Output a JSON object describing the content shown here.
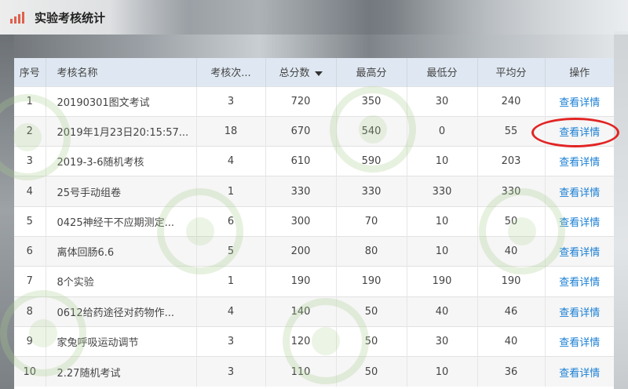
{
  "header": {
    "title": "实验考核统计"
  },
  "table": {
    "columns": [
      {
        "label": "序号"
      },
      {
        "label": "考核名称"
      },
      {
        "label": "考核次..."
      },
      {
        "label": "总分数"
      },
      {
        "label": "最高分"
      },
      {
        "label": "最低分"
      },
      {
        "label": "平均分"
      },
      {
        "label": "操作"
      }
    ],
    "sorted_column": "总分数",
    "sort_direction": "desc",
    "rows": [
      {
        "no": "1",
        "name": "20190301图文考试",
        "count": "3",
        "total": "720",
        "max": "350",
        "min": "30",
        "avg": "240",
        "action": "查看详情"
      },
      {
        "no": "2",
        "name": "2019年1月23日20:15:57...",
        "count": "18",
        "total": "670",
        "max": "540",
        "min": "0",
        "avg": "55",
        "action": "查看详情"
      },
      {
        "no": "3",
        "name": "2019-3-6随机考核",
        "count": "4",
        "total": "610",
        "max": "590",
        "min": "10",
        "avg": "203",
        "action": "查看详情"
      },
      {
        "no": "4",
        "name": "25号手动组卷",
        "count": "1",
        "total": "330",
        "max": "330",
        "min": "330",
        "avg": "330",
        "action": "查看详情"
      },
      {
        "no": "5",
        "name": "0425神经干不应期测定...",
        "count": "6",
        "total": "300",
        "max": "70",
        "min": "10",
        "avg": "50",
        "action": "查看详情"
      },
      {
        "no": "6",
        "name": "离体回肠6.6",
        "count": "5",
        "total": "200",
        "max": "80",
        "min": "10",
        "avg": "40",
        "action": "查看详情"
      },
      {
        "no": "7",
        "name": "8个实验",
        "count": "1",
        "total": "190",
        "max": "190",
        "min": "190",
        "avg": "190",
        "action": "查看详情"
      },
      {
        "no": "8",
        "name": "0612给药途径对药物作...",
        "count": "4",
        "total": "140",
        "max": "50",
        "min": "40",
        "avg": "46",
        "action": "查看详情"
      },
      {
        "no": "9",
        "name": "家兔呼吸运动调节",
        "count": "3",
        "total": "120",
        "max": "50",
        "min": "30",
        "avg": "40",
        "action": "查看详情"
      },
      {
        "no": "10",
        "name": "2.27随机考试",
        "count": "3",
        "total": "110",
        "max": "50",
        "min": "10",
        "avg": "36",
        "action": "查看详情"
      }
    ]
  },
  "annotation": {
    "highlighted_row": 2,
    "color": "#e22424"
  },
  "colors": {
    "link": "#1a7fd4",
    "header_bg": "#dfe8f2",
    "stripe": "#f6f6f6"
  }
}
